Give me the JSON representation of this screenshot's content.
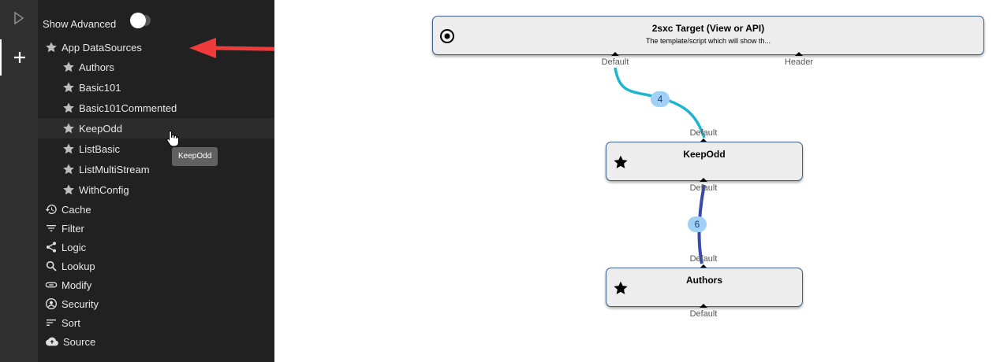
{
  "rail": {
    "play_icon": "play-icon",
    "add_icon": "plus-icon"
  },
  "sidebar": {
    "show_advanced_label": "Show Advanced",
    "show_advanced_on": false,
    "app_datasources": {
      "label": "App DataSources",
      "items": [
        {
          "label": "Authors"
        },
        {
          "label": "Basic101"
        },
        {
          "label": "Basic101Commented"
        },
        {
          "label": "KeepOdd"
        },
        {
          "label": "ListBasic"
        },
        {
          "label": "ListMultiStream"
        },
        {
          "label": "WithConfig"
        }
      ]
    },
    "categories": [
      {
        "label": "Cache",
        "icon": "history-icon"
      },
      {
        "label": "Filter",
        "icon": "filter-icon"
      },
      {
        "label": "Logic",
        "icon": "share-icon"
      },
      {
        "label": "Lookup",
        "icon": "search-icon"
      },
      {
        "label": "Modify",
        "icon": "link-icon"
      },
      {
        "label": "Security",
        "icon": "account-circle-icon"
      },
      {
        "label": "Sort",
        "icon": "sort-icon"
      },
      {
        "label": "Source",
        "icon": "cloud-upload-icon"
      }
    ],
    "tooltip": "KeepOdd"
  },
  "canvas": {
    "target": {
      "title": "2sxc Target (View or API)",
      "description": "The template/script which will show th...",
      "icon": "target-icon",
      "in_ports": [
        "Default",
        "Header"
      ]
    },
    "keepodd": {
      "title": "KeepOdd",
      "icon": "star-icon",
      "in_port": "Default",
      "out_port": "Default"
    },
    "authors": {
      "title": "Authors",
      "icon": "star-icon",
      "in_port": "Default",
      "out_port": "Default"
    },
    "connections": [
      {
        "from": "KeepOdd",
        "to": "2sxc Target",
        "count": "4",
        "color": "#1bb5d0"
      },
      {
        "from": "Authors",
        "to": "KeepOdd",
        "count": "6",
        "color": "#3949ab"
      }
    ]
  },
  "annotation": {
    "arrow_color": "#ef3b3b"
  }
}
